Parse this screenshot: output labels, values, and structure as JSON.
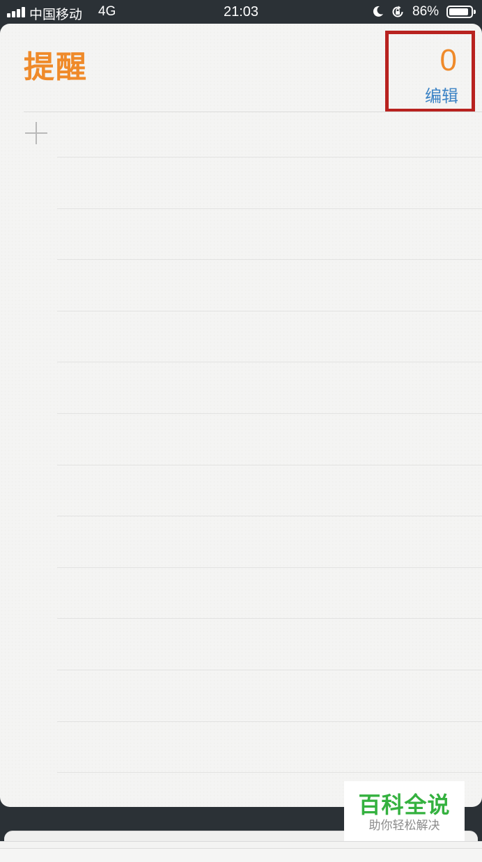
{
  "status_bar": {
    "carrier": "中国移动",
    "network": "4G",
    "time": "21:03",
    "battery": "86%",
    "icons": [
      "signal-icon",
      "moon-icon",
      "rotation-lock-icon",
      "battery-icon"
    ]
  },
  "reminders": {
    "title": "提醒",
    "count": "0",
    "edit_label": "编辑",
    "add_icon": "plus-icon",
    "rule_line_count": 13
  },
  "watermark": {
    "title": "百科全说",
    "subtitle": "助你轻松解决"
  },
  "colors": {
    "accent_orange": "#ef8a2a",
    "link_blue": "#3c83c5",
    "highlight_red": "#b8221f",
    "watermark_green": "#34b13f",
    "background_dark": "#2b3136",
    "paper": "#f4f4f3"
  }
}
